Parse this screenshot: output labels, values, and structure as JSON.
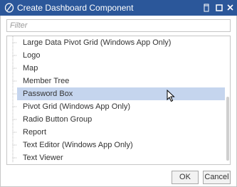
{
  "window": {
    "title": "Create Dashboard Component",
    "title_bg": "#2b579a"
  },
  "icons": {
    "app": "dashboard-component-icon",
    "restore": "restore-icon",
    "maximize": "maximize-icon",
    "close": "close-icon",
    "cursor": "mouse-cursor-icon"
  },
  "filter": {
    "placeholder": "Filter",
    "value": ""
  },
  "tree": {
    "items": [
      {
        "label": "Large Data Pivot Grid (Windows App Only)"
      },
      {
        "label": "Logo"
      },
      {
        "label": "Map"
      },
      {
        "label": "Member Tree"
      },
      {
        "label": "Password Box",
        "selected": true
      },
      {
        "label": "Pivot Grid (Windows App Only)"
      },
      {
        "label": "Radio Button Group"
      },
      {
        "label": "Report"
      },
      {
        "label": "Text Editor (Windows App Only)"
      },
      {
        "label": "Text Viewer"
      }
    ],
    "selected_bg": "#c5d5ee"
  },
  "buttons": {
    "ok": "OK",
    "cancel": "Cancel"
  }
}
